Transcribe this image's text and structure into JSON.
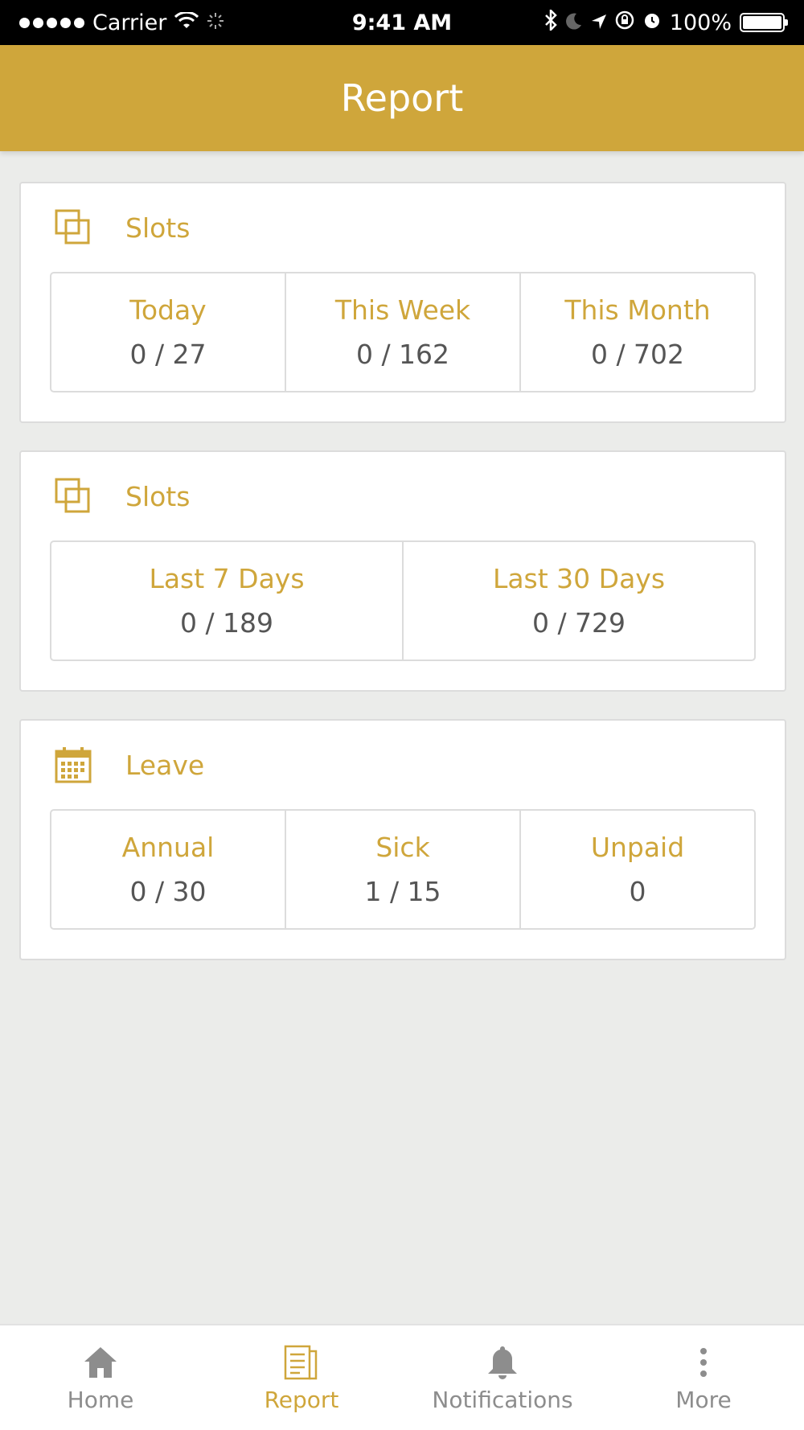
{
  "status_bar": {
    "carrier": "Carrier",
    "time": "9:41 AM",
    "battery": "100%"
  },
  "header": {
    "title": "Report"
  },
  "cards": [
    {
      "title": "Slots",
      "icon": "copy-icon",
      "stats": [
        {
          "label": "Today",
          "value": "0 / 27"
        },
        {
          "label": "This Week",
          "value": "0 / 162"
        },
        {
          "label": "This Month",
          "value": "0 / 702"
        }
      ]
    },
    {
      "title": "Slots",
      "icon": "copy-icon",
      "stats": [
        {
          "label": "Last 7 Days",
          "value": "0 / 189"
        },
        {
          "label": "Last 30 Days",
          "value": "0 / 729"
        }
      ]
    },
    {
      "title": "Leave",
      "icon": "calendar-icon",
      "stats": [
        {
          "label": "Annual",
          "value": "0 / 30"
        },
        {
          "label": "Sick",
          "value": "1 / 15"
        },
        {
          "label": "Unpaid",
          "value": "0"
        }
      ]
    }
  ],
  "tabs": [
    {
      "label": "Home",
      "icon": "home-icon",
      "active": false
    },
    {
      "label": "Report",
      "icon": "report-icon",
      "active": true
    },
    {
      "label": "Notifications",
      "icon": "bell-icon",
      "active": false
    },
    {
      "label": "More",
      "icon": "more-vertical-icon",
      "active": false
    }
  ],
  "colors": {
    "accent": "#cfa63b",
    "inactive": "#8d8d8d",
    "background": "#ebecea"
  }
}
